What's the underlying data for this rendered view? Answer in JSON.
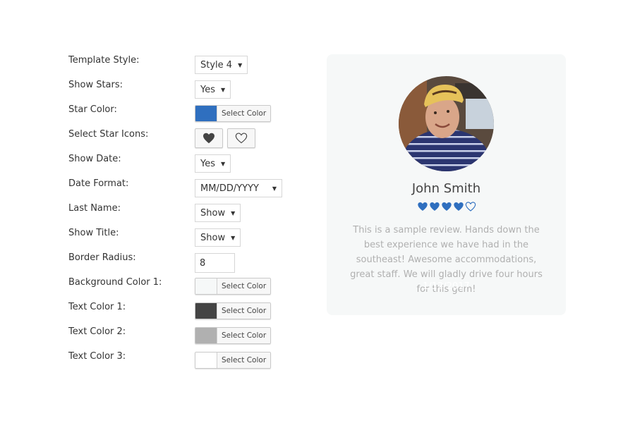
{
  "settings": {
    "template_style": {
      "label": "Template Style:",
      "value": "Style 4"
    },
    "show_stars": {
      "label": "Show Stars:",
      "value": "Yes"
    },
    "star_color": {
      "label": "Star Color:",
      "color": "#2f6fbf",
      "button": "Select Color"
    },
    "star_icons": {
      "label": "Select Star Icons:",
      "options": [
        "heart-filled-icon",
        "heart-outline-icon"
      ]
    },
    "show_date": {
      "label": "Show Date:",
      "value": "Yes"
    },
    "date_format": {
      "label": "Date Format:",
      "value": "MM/DD/YYYY"
    },
    "last_name": {
      "label": "Last Name:",
      "value": "Show"
    },
    "show_title": {
      "label": "Show Title:",
      "value": "Show"
    },
    "border_radius": {
      "label": "Border Radius:",
      "value": "8"
    },
    "background_color_1": {
      "label": "Background Color 1:",
      "color": "#f6f8f8",
      "button": "Select Color"
    },
    "text_color_1": {
      "label": "Text Color 1:",
      "color": "#444444",
      "button": "Select Color"
    },
    "text_color_2": {
      "label": "Text Color 2:",
      "color": "#b0b0b0",
      "button": "Select Color"
    },
    "text_color_3": {
      "label": "Text Color 3:",
      "color": "#ffffff",
      "button": "Select Color"
    }
  },
  "preview": {
    "name": "John Smith",
    "rating": 4,
    "rating_max": 5,
    "star_color": "#2f6fbf",
    "review": "This is a sample review. Hands down the best experience we have had in the southeast! Awesome accommodations, great staff. We will gladly drive four hours for this gem!",
    "date": "1/12/2017",
    "avatar_alt": "reviewer-photo"
  }
}
